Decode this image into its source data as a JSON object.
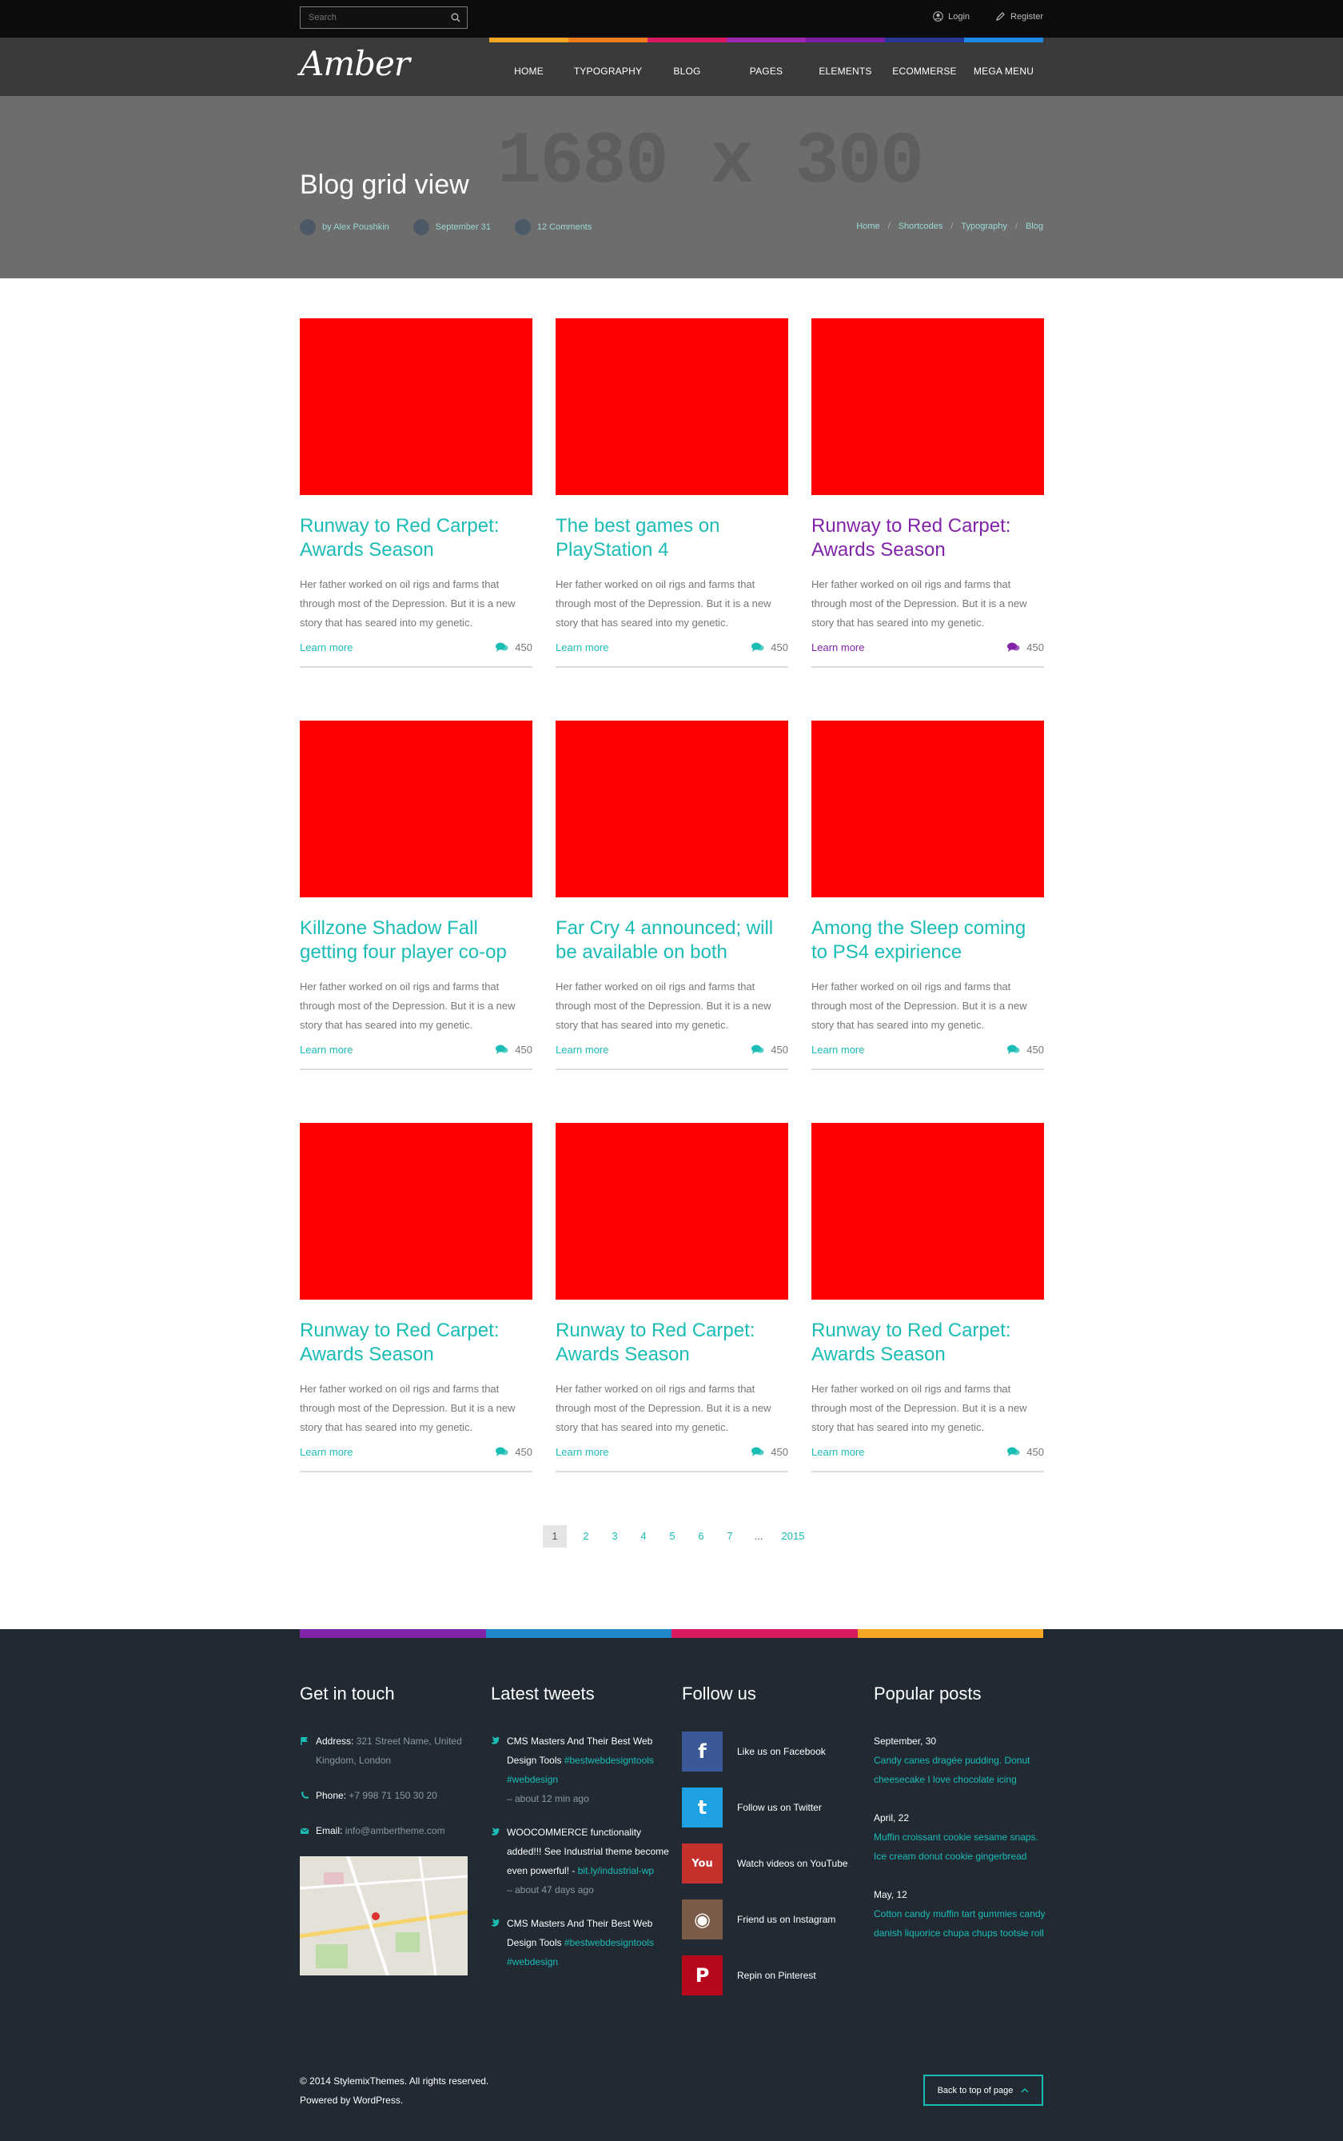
{
  "topbar": {
    "search_placeholder": "Search",
    "login": "Login",
    "register": "Register"
  },
  "nav": {
    "logo": "Amber",
    "items": [
      {
        "label": "HOME",
        "color": "#f5a623"
      },
      {
        "label": "TYPOGRAPHY",
        "color": "#f07b1d"
      },
      {
        "label": "BLOG",
        "color": "#d81b60"
      },
      {
        "label": "PAGES",
        "color": "#9c27b0"
      },
      {
        "label": "ELEMENTS",
        "color": "#7b1fa2"
      },
      {
        "label": "ECOMMERSE",
        "color": "#283593"
      },
      {
        "label": "MEGA MENU",
        "color": "#1e88e5"
      }
    ]
  },
  "hero": {
    "placeholder": "1680 x 300",
    "title": "Blog grid view",
    "author": "by Alex Poushkin",
    "date": "September 31",
    "comments": "12 Comments",
    "breadcrumb": [
      "Home",
      "Shortcodes",
      "Typography",
      "Blog"
    ]
  },
  "posts": [
    {
      "title": "Runway to Red Carpet: Awards Season",
      "excerpt": "Her father worked on oil rigs and farms that through most of the Depression. But it is a new story that has seared into my genetic.",
      "link": "Learn more",
      "count": "450"
    },
    {
      "title": "The best games on PlayStation 4",
      "excerpt": "Her father worked on oil rigs and farms that through most of the Depression. But it is a new story that has seared into my genetic.",
      "link": "Learn more",
      "count": "450"
    },
    {
      "title": "Runway to Red Carpet: Awards Season",
      "excerpt": "Her father worked on oil rigs and farms that through most of the Depression. But it is a new story that has seared into my genetic.",
      "link": "Learn more",
      "count": "450"
    },
    {
      "title": "Killzone Shadow Fall getting four player co-op",
      "excerpt": "Her father worked on oil rigs and farms that through most of the Depression. But it is a new story that has seared into my genetic.",
      "link": "Learn more",
      "count": "450"
    },
    {
      "title": "Far Cry 4 announced; will be available on both",
      "excerpt": "Her father worked on oil rigs and farms that through most of the Depression. But it is a new story that has seared into my genetic.",
      "link": "Learn more",
      "count": "450"
    },
    {
      "title": "Among the Sleep coming to PS4 expirience",
      "excerpt": "Her father worked on oil rigs and farms that through most of the Depression. But it is a new story that has seared into my genetic.",
      "link": "Learn more",
      "count": "450"
    },
    {
      "title": "Runway to Red Carpet: Awards Season",
      "excerpt": "Her father worked on oil rigs and farms that through most of the Depression. But it is a new story that has seared into my genetic.",
      "link": "Learn more",
      "count": "450"
    },
    {
      "title": "Runway to Red Carpet: Awards Season",
      "excerpt": "Her father worked on oil rigs and farms that through most of the Depression. But it is a new story that has seared into my genetic.",
      "link": "Learn more",
      "count": "450"
    },
    {
      "title": "Runway to Red Carpet: Awards Season",
      "excerpt": "Her father worked on oil rigs and farms that through most of the Depression. But it is a new story that has seared into my genetic.",
      "link": "Learn more",
      "count": "450"
    }
  ],
  "pagination": [
    "1",
    "2",
    "3",
    "4",
    "5",
    "6",
    "7",
    "...",
    "2015"
  ],
  "footer": {
    "bar_colors": [
      "#8224a9",
      "#1e88c9",
      "#d81b60",
      "#f5a623"
    ],
    "contact": {
      "heading": "Get in touch",
      "address_label": "Address:",
      "address": "321 Street Name, United Kingdom, London",
      "phone_label": "Phone:",
      "phone": "+7 998 71 150 30 20",
      "email_label": "Email:",
      "email": "info@ambertheme.com"
    },
    "tweets": {
      "heading": "Latest tweets",
      "items": [
        {
          "text": "CMS Masters And Their Best Web Design Tools",
          "tag": "#bestwebdesigntools #webdesign",
          "time": "– about 12 min ago"
        },
        {
          "text": "WOOCOMMERCE functionality added!!! See Industrial theme become even powerful! -",
          "tag": "bit.ly/industrial-wp",
          "time": "– about 47 days ago"
        },
        {
          "text": "CMS Masters And Their Best Web Design Tools",
          "tag": "#bestwebdesigntools #webdesign",
          "time": ""
        }
      ]
    },
    "follow": {
      "heading": "Follow us",
      "items": [
        {
          "label": "Like us on Facebook",
          "color": "#3b5998",
          "glyph": "f"
        },
        {
          "label": "Follow us on Twitter",
          "color": "#1da1e2",
          "glyph": "t"
        },
        {
          "label": "Watch videos on YouTube",
          "color": "#c4302b",
          "glyph": "You"
        },
        {
          "label": "Friend us on Instagram",
          "color": "#7a5a48",
          "glyph": "◉"
        },
        {
          "label": "Repin on Pinterest",
          "color": "#b7081b",
          "glyph": "P"
        }
      ]
    },
    "popular": {
      "heading": "Popular posts",
      "items": [
        {
          "date": "September, 30",
          "text": "Candy canes dragée pudding. Donut cheesecake I love chocolate icing"
        },
        {
          "date": "April, 22",
          "text": "Muffin croissant cookie sesame snaps. Ice cream donut cookie gingerbread"
        },
        {
          "date": "May, 12",
          "text": "Cotton candy muffin tart gummies candy danish liquorice chupa chups tootsie roll"
        }
      ]
    },
    "copyright": "© 2014 StylemixThemes. All rights reserved.",
    "powered": "Powered by WordPress.",
    "back_to_top": "Back to top of page"
  }
}
